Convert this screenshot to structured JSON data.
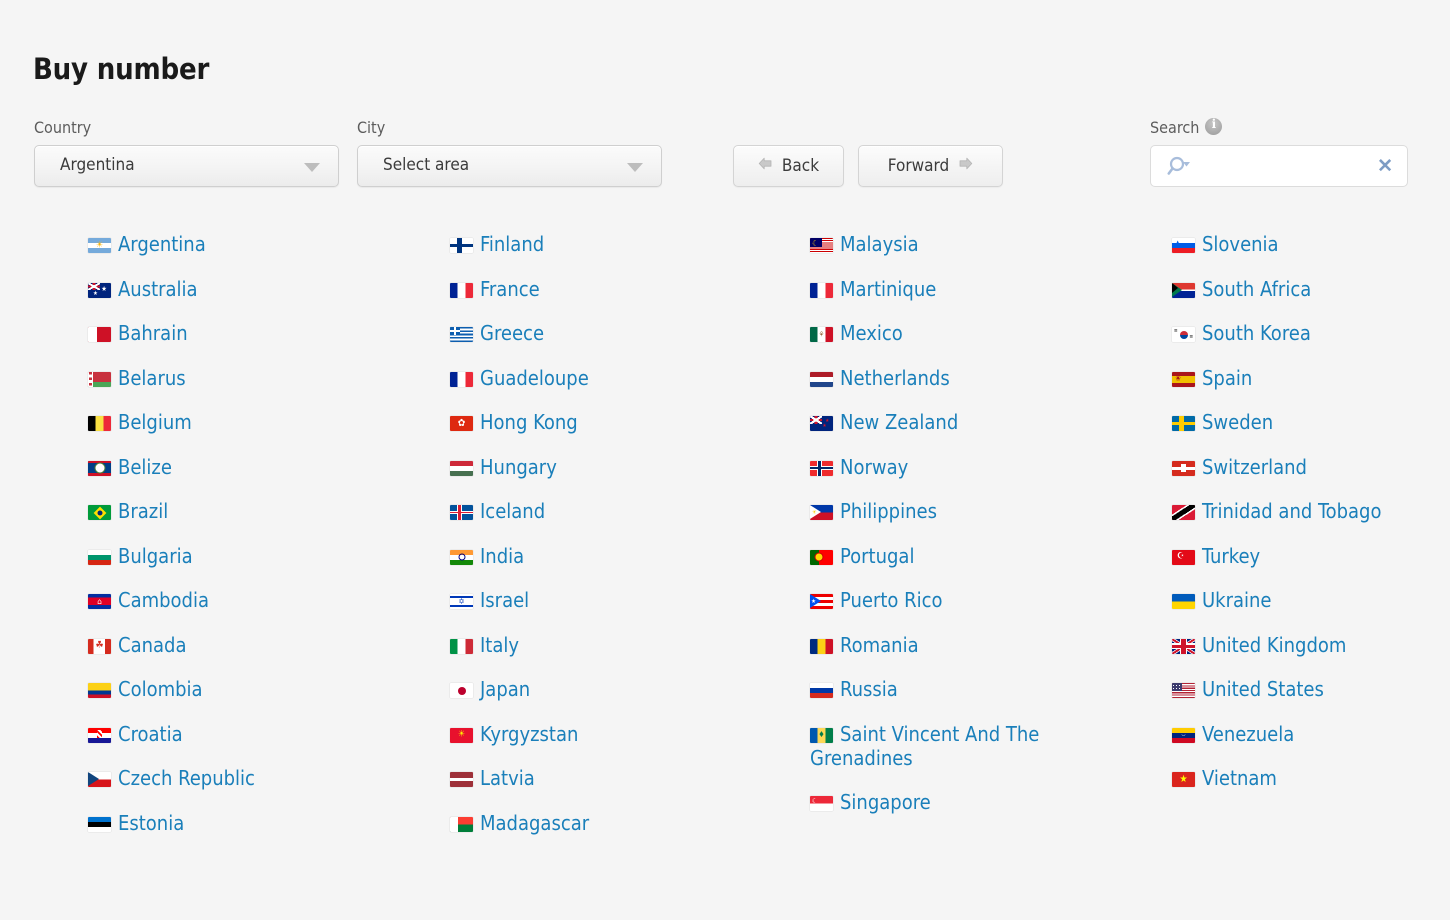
{
  "header": {
    "title": "Buy number"
  },
  "form": {
    "country": {
      "label": "Country",
      "value": "Argentina"
    },
    "city": {
      "label": "City",
      "value": "Select area"
    },
    "back_label": "Back",
    "forward_label": "Forward",
    "search": {
      "label": "Search",
      "value": "",
      "placeholder": "",
      "clear_label": "✕",
      "info_icon": "info-icon",
      "search_icon": "search-icon"
    }
  },
  "colors": {
    "background": "#f5f5f5",
    "link": "#1a7fba",
    "title": "#1a1a1a",
    "label": "#5c5c5c",
    "button_text": "#3c3c3c"
  },
  "columns": [
    [
      {
        "name": "Argentina",
        "flag": "ar"
      },
      {
        "name": "Australia",
        "flag": "au"
      },
      {
        "name": "Bahrain",
        "flag": "bh"
      },
      {
        "name": "Belarus",
        "flag": "by"
      },
      {
        "name": "Belgium",
        "flag": "be"
      },
      {
        "name": "Belize",
        "flag": "bz"
      },
      {
        "name": "Brazil",
        "flag": "br"
      },
      {
        "name": "Bulgaria",
        "flag": "bg"
      },
      {
        "name": "Cambodia",
        "flag": "kh"
      },
      {
        "name": "Canada",
        "flag": "ca"
      },
      {
        "name": "Colombia",
        "flag": "co"
      },
      {
        "name": "Croatia",
        "flag": "hr"
      },
      {
        "name": "Czech Republic",
        "flag": "cz"
      },
      {
        "name": "Estonia",
        "flag": "ee"
      }
    ],
    [
      {
        "name": "Finland",
        "flag": "fi"
      },
      {
        "name": "France",
        "flag": "fr"
      },
      {
        "name": "Greece",
        "flag": "gr"
      },
      {
        "name": "Guadeloupe",
        "flag": "gp"
      },
      {
        "name": "Hong Kong",
        "flag": "hk"
      },
      {
        "name": "Hungary",
        "flag": "hu"
      },
      {
        "name": "Iceland",
        "flag": "is"
      },
      {
        "name": "India",
        "flag": "in"
      },
      {
        "name": "Israel",
        "flag": "il"
      },
      {
        "name": "Italy",
        "flag": "it"
      },
      {
        "name": "Japan",
        "flag": "jp"
      },
      {
        "name": "Kyrgyzstan",
        "flag": "kg"
      },
      {
        "name": "Latvia",
        "flag": "lv"
      },
      {
        "name": "Madagascar",
        "flag": "mg"
      }
    ],
    [
      {
        "name": "Malaysia",
        "flag": "my"
      },
      {
        "name": "Martinique",
        "flag": "mq"
      },
      {
        "name": "Mexico",
        "flag": "mx"
      },
      {
        "name": "Netherlands",
        "flag": "nl"
      },
      {
        "name": "New Zealand",
        "flag": "nz"
      },
      {
        "name": "Norway",
        "flag": "no"
      },
      {
        "name": "Philippines",
        "flag": "ph"
      },
      {
        "name": "Portugal",
        "flag": "pt"
      },
      {
        "name": "Puerto Rico",
        "flag": "pr"
      },
      {
        "name": "Romania",
        "flag": "ro"
      },
      {
        "name": "Russia",
        "flag": "ru"
      },
      {
        "name": "Saint Vincent And The Grenadines",
        "flag": "vc"
      },
      {
        "name": "Singapore",
        "flag": "sg"
      }
    ],
    [
      {
        "name": "Slovenia",
        "flag": "si"
      },
      {
        "name": "South Africa",
        "flag": "za"
      },
      {
        "name": "South Korea",
        "flag": "kr"
      },
      {
        "name": "Spain",
        "flag": "es"
      },
      {
        "name": "Sweden",
        "flag": "se"
      },
      {
        "name": "Switzerland",
        "flag": "ch"
      },
      {
        "name": "Trinidad and Tobago",
        "flag": "tt"
      },
      {
        "name": "Turkey",
        "flag": "tr"
      },
      {
        "name": "Ukraine",
        "flag": "ua"
      },
      {
        "name": "United Kingdom",
        "flag": "gb"
      },
      {
        "name": "United States",
        "flag": "us"
      },
      {
        "name": "Venezuela",
        "flag": "ve"
      },
      {
        "name": "Vietnam",
        "flag": "vn"
      }
    ]
  ]
}
